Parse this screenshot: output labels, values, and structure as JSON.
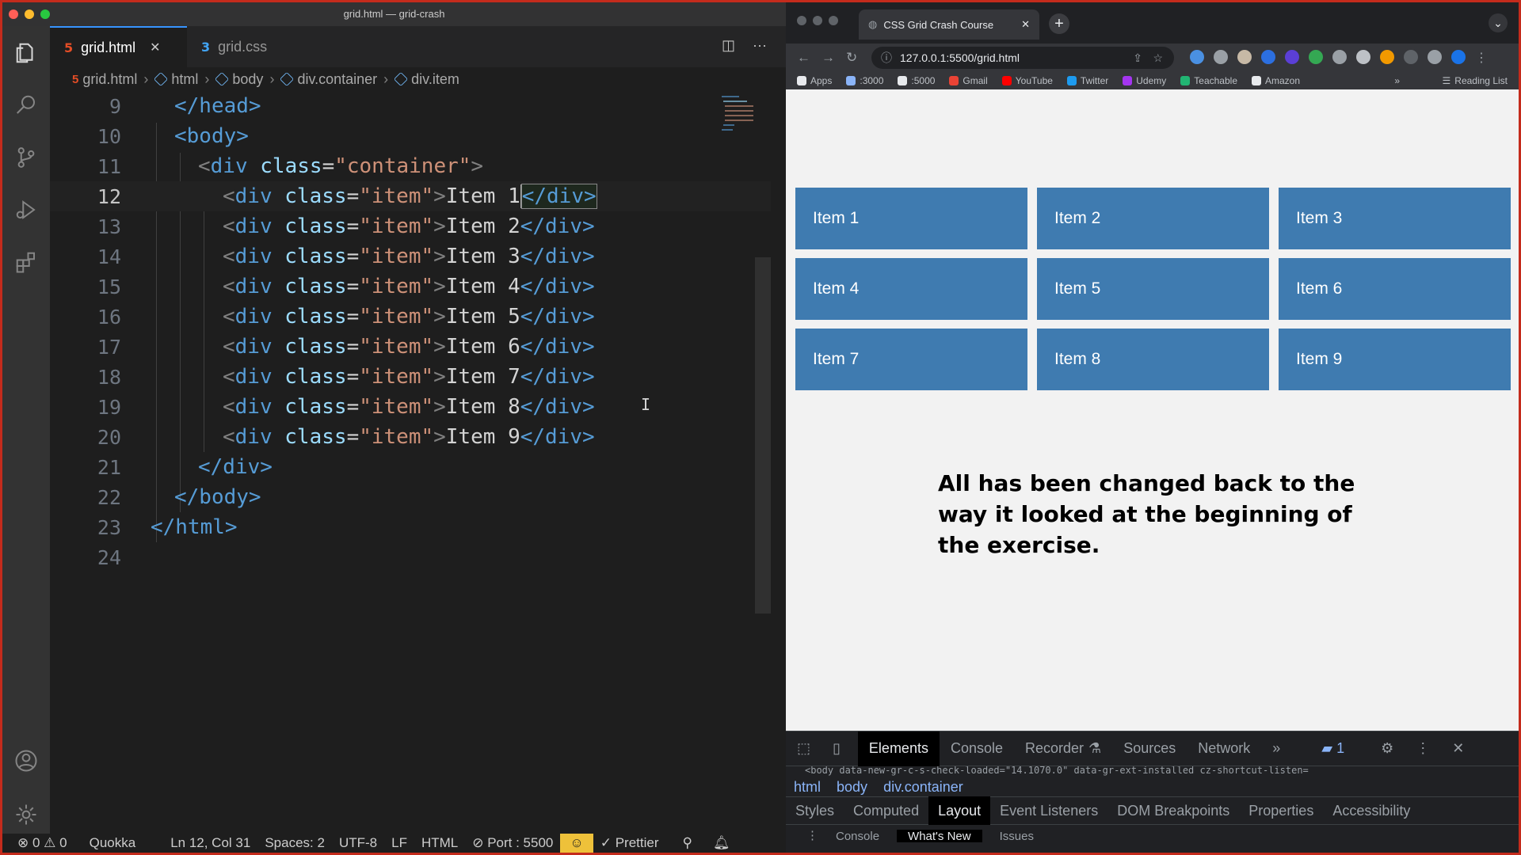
{
  "vscode": {
    "window_title": "grid.html — grid-crash",
    "tabs": [
      {
        "label": "grid.html",
        "icon": "5",
        "icon_color": "#e44d26",
        "active": true
      },
      {
        "label": "grid.css",
        "icon": "3",
        "icon_color": "#42a5f5",
        "active": false
      }
    ],
    "breadcrumb": [
      "grid.html",
      "html",
      "body",
      "div.container",
      "div.item"
    ],
    "code_lines": [
      {
        "num": "9"
      },
      {
        "num": "10"
      },
      {
        "num": "11"
      },
      {
        "num": "12"
      },
      {
        "num": "13"
      },
      {
        "num": "14"
      },
      {
        "num": "15"
      },
      {
        "num": "16"
      },
      {
        "num": "17"
      },
      {
        "num": "18"
      },
      {
        "num": "19"
      },
      {
        "num": "20"
      },
      {
        "num": "21"
      },
      {
        "num": "22"
      },
      {
        "num": "23"
      },
      {
        "num": "24"
      }
    ],
    "code_text": {
      "head_close": "</head>",
      "body_open": "<body>",
      "container_open": [
        "<",
        "div",
        " ",
        "class",
        "=",
        "\"container\"",
        ">"
      ],
      "item_prefix": [
        "<",
        "div",
        " ",
        "class",
        "=",
        "\"item\"",
        ">"
      ],
      "item_texts": [
        "Item 1",
        "Item 2",
        "Item 3",
        "Item 4",
        "Item 5",
        "Item 6",
        "Item 7",
        "Item 8",
        "Item 9"
      ],
      "div_close": "</div>",
      "body_close": "</body>",
      "html_close": "</html>"
    },
    "status": {
      "errors": "0",
      "warnings": "0",
      "quokka": "Quokka",
      "position": "Ln 12, Col 31",
      "spaces": "Spaces: 2",
      "encoding": "UTF-8",
      "eol": "LF",
      "language": "HTML",
      "port": "Port : 5500",
      "prettier": "Prettier"
    }
  },
  "browser": {
    "tab_title": "CSS Grid Crash Course",
    "url": "127.0.0.1:5500/grid.html",
    "bookmarks": [
      {
        "label": "Apps",
        "color": "#e8eaed"
      },
      {
        "label": ":3000",
        "color": "#8ab4f8"
      },
      {
        "label": ":5000",
        "color": "#e8eaed"
      },
      {
        "label": "Gmail",
        "color": "#ea4335"
      },
      {
        "label": "YouTube",
        "color": "#ff0000"
      },
      {
        "label": "Twitter",
        "color": "#1d9bf0"
      },
      {
        "label": "Udemy",
        "color": "#a435f0"
      },
      {
        "label": "Teachable",
        "color": "#21b573"
      },
      {
        "label": "Amazon",
        "color": "#e8eaed"
      }
    ],
    "reading_list": "Reading List",
    "grid_items": [
      "Item 1",
      "Item 2",
      "Item 3",
      "Item 4",
      "Item 5",
      "Item 6",
      "Item 7",
      "Item 8",
      "Item 9"
    ],
    "note": "All has been changed back to the way it looked at the beginning of the exercise.",
    "devtools": {
      "tabs": [
        "Elements",
        "Console",
        "Recorder",
        "Sources",
        "Network"
      ],
      "active_tab": "Elements",
      "message_count": "1",
      "dom_snippet": "<body data-new-gr-c-s-check-loaded=\"14.1070.0\" data-gr-ext-installed cz-shortcut-listen=",
      "crumbs": [
        "html",
        "body",
        "div.container"
      ],
      "panels": [
        "Styles",
        "Computed",
        "Layout",
        "Event Listeners",
        "DOM Breakpoints",
        "Properties",
        "Accessibility"
      ],
      "active_panel": "Layout",
      "drawer_tabs": [
        "Console",
        "What's New",
        "Issues"
      ]
    }
  },
  "colors": {
    "grid_item_bg": "#3f7bb0",
    "frame_border": "#c42b1c",
    "editor_bg": "#1e1e1e",
    "tag": "#569cd6",
    "attr": "#9cdcfe",
    "string": "#ce9178"
  }
}
